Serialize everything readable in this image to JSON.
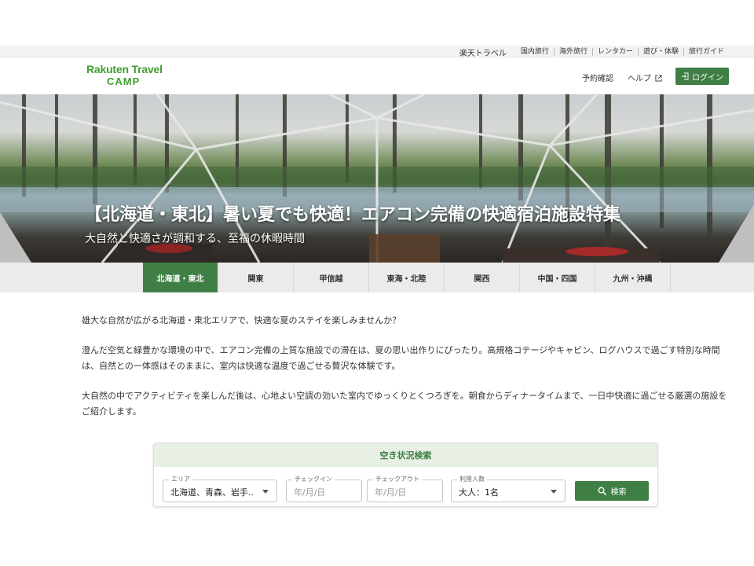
{
  "util_bar": {
    "brand": "楽天トラベル",
    "links": [
      "国内旅行",
      "海外旅行",
      "レンタカー",
      "遊び・体験",
      "旅行ガイド"
    ]
  },
  "header": {
    "logo_line1": "Rakuten Travel",
    "logo_line2": "CAMP",
    "reserve_label": "予約確認",
    "help_label": "ヘルプ",
    "login_label": "ログイン"
  },
  "hero": {
    "title": "【北海道・東北】暑い夏でも快適！エアコン完備の快適宿泊施設特集",
    "subtitle": "大自然と快適さが調和する、至福の休暇時間"
  },
  "tabs": [
    {
      "label": "北海道・東北",
      "active": true
    },
    {
      "label": "関東",
      "active": false
    },
    {
      "label": "甲信越",
      "active": false
    },
    {
      "label": "東海・北陸",
      "active": false
    },
    {
      "label": "関西",
      "active": false
    },
    {
      "label": "中国・四国",
      "active": false
    },
    {
      "label": "九州・沖縄",
      "active": false
    }
  ],
  "content": {
    "p1": "雄大な自然が広がる北海道・東北エリアで、快適な夏のステイを楽しみませんか？",
    "p2": "澄んだ空気と緑豊かな環境の中で、エアコン完備の上質な施設での滞在は、夏の思い出作りにぴったり。高規格コテージやキャビン、ログハウスで過ごす特別な時間は、自然との一体感はそのままに、室内は快適な温度で過ごせる贅沢な体験です。",
    "p3": "大自然の中でアクティビティを楽しんだ後は、心地よい空調の効いた室内でゆっくりとくつろぎを。朝食からディナータイムまで、一日中快適に過ごせる厳選の施設をご紹介します。"
  },
  "search": {
    "heading": "空き状況検索",
    "area_label": "エリア",
    "area_value": "北海道、青森、岩手..",
    "checkin_label": "チェックイン",
    "checkin_placeholder": "年/月/日",
    "checkout_label": "チェックアウト",
    "checkout_placeholder": "年/月/日",
    "people_label": "利用人数",
    "people_value": "大人：1名",
    "button_label": "検索"
  },
  "colors": {
    "brand_green": "#3f9f2f",
    "accent_green": "#3f7f45",
    "search_head_bg": "#e8f0e6"
  }
}
